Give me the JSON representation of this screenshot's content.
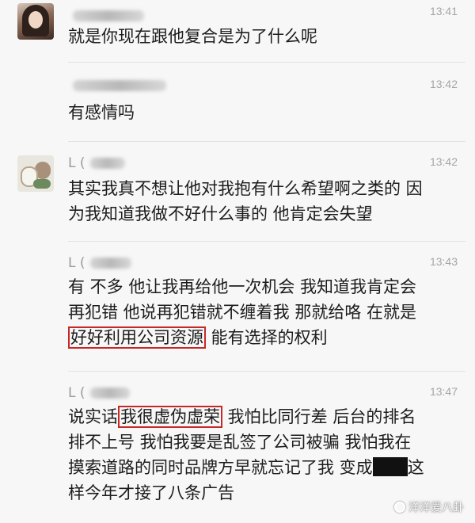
{
  "messages": [
    {
      "sender": "",
      "time": "13:41",
      "lines": [
        "就是你现在跟他复合是为了什么呢"
      ]
    },
    {
      "sender": "",
      "time": "13:42",
      "lines": [
        "有感情吗"
      ]
    },
    {
      "sender": "L (",
      "time": "13:42",
      "lines": [
        "其实我真不想让他对我抱有什么希望啊之类的 因",
        "为我知道我做不好什么事的 他肯定会失望"
      ]
    },
    {
      "sender": "L (",
      "time": "13:43",
      "line1": "有 不多 他让我再给他一次机会 我知道我肯定会",
      "line2": "再犯错 他说再犯错就不缠着我 那就给咯 在就是",
      "line3_highlight": "好好利用公司资源",
      "line3_rest": " 能有选择的权利"
    },
    {
      "sender": "L (",
      "time": "13:47",
      "line1_pre": "说实话",
      "line1_highlight": "我很虚伪虚荣",
      "line1_post": " 我怕比同行差 后台的排名",
      "line2": "排不上号 我怕我要是乱签了公司被骗 我怕我在",
      "line3_pre": "摸索道路的同时品牌方早就忘记了我 变成",
      "line3_post": "这",
      "line4": "样今年才接了八条广告"
    }
  ],
  "watermark": "洋洋爱八卦"
}
